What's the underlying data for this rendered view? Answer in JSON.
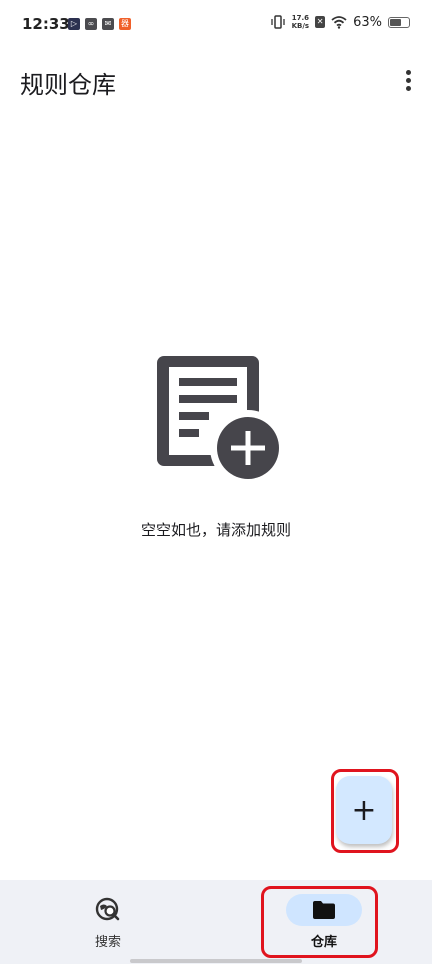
{
  "status_bar": {
    "time": "12:33",
    "notifications": [
      {
        "icon": "play-store-icon",
        "glyph": "▷"
      },
      {
        "icon": "bird-icon",
        "glyph": "∞"
      },
      {
        "icon": "mail-icon",
        "glyph": "✉"
      },
      {
        "icon": "app-badge-icon",
        "glyph": "器"
      }
    ],
    "net_speed_value": "17.6",
    "net_speed_unit": "KB/s",
    "sim_glyph": "✕",
    "battery_percent": "63%",
    "battery_level": 0.63
  },
  "app_bar": {
    "title": "规则仓库",
    "more_icon": "more-vert-icon"
  },
  "empty_state": {
    "icon": "playlist-add-icon",
    "message": "空空如也，请添加规则"
  },
  "fab": {
    "icon": "plus-icon",
    "glyph": "+"
  },
  "bottom_nav": {
    "items": [
      {
        "label": "搜索",
        "icon": "search-web-icon",
        "selected": false
      },
      {
        "label": "仓库",
        "icon": "folder-icon",
        "selected": true
      }
    ]
  },
  "colors": {
    "fab_background": "#d3e8ff",
    "nav_background": "#eff1f6",
    "nav_selected_indicator": "#cfe5ff",
    "highlight_box": "#e0141e",
    "empty_icon": "#46454b"
  }
}
